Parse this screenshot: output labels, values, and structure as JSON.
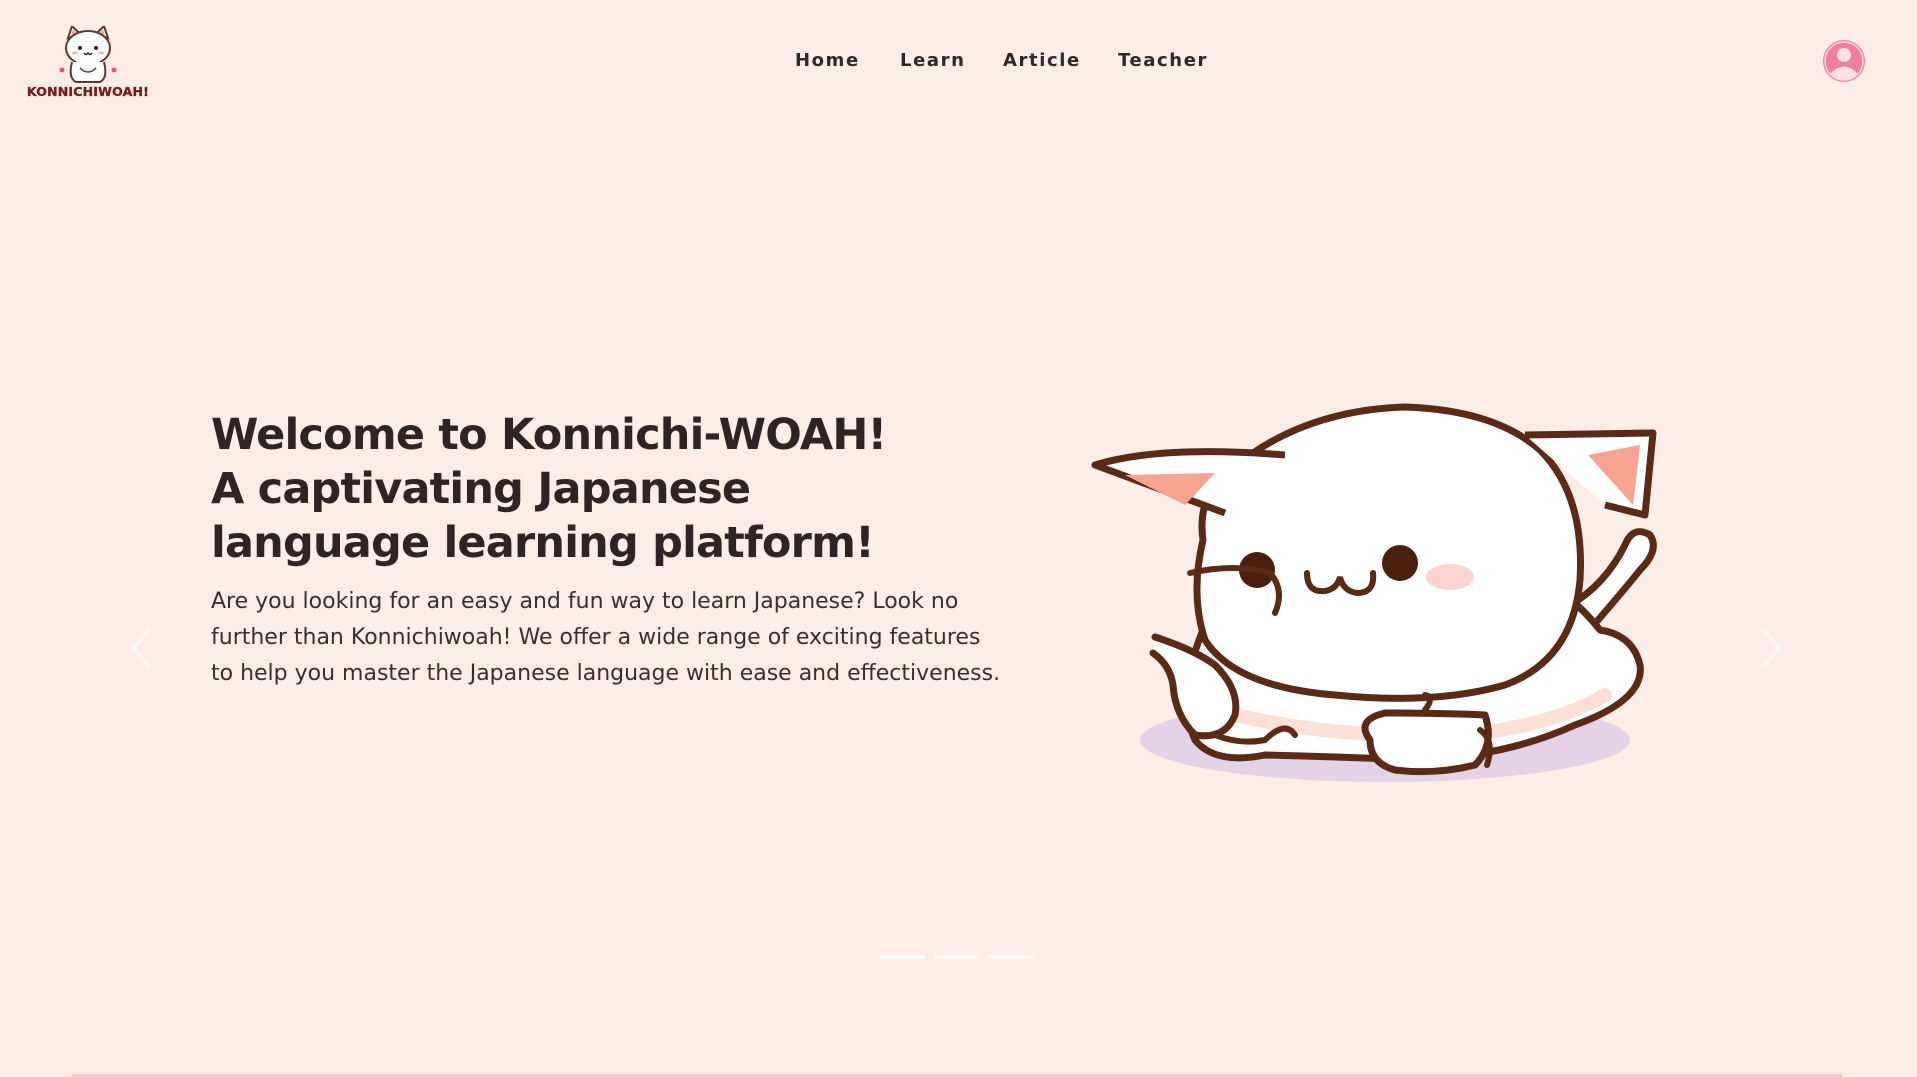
{
  "header": {
    "logo_text": "KONNICHIWOAH!",
    "nav": {
      "home": "Home",
      "learn": "Learn",
      "article": "Article",
      "teacher": "Teacher"
    },
    "account_icon": "user-circle-icon"
  },
  "hero": {
    "title_lines": [
      "Welcome to Konnichi-WOAH!",
      "A captivating Japanese",
      "language learning platform!"
    ],
    "description": "Are you looking for an easy and fun way to learn Japanese? Look no further than Konnichiwoah! We offer a wide range of exciting features to help you master the Japanese language with ease and effectiveness.",
    "illustration": "cat-lying-illustration"
  },
  "carousel": {
    "prev_icon": "chevron-left-icon",
    "next_icon": "chevron-right-icon",
    "slide_count": 3,
    "active_slide": 1
  },
  "colors": {
    "background": "#fcede6",
    "text": "#2e2424",
    "accent": "#f07f9c",
    "cat_outline": "#5a2a17"
  }
}
